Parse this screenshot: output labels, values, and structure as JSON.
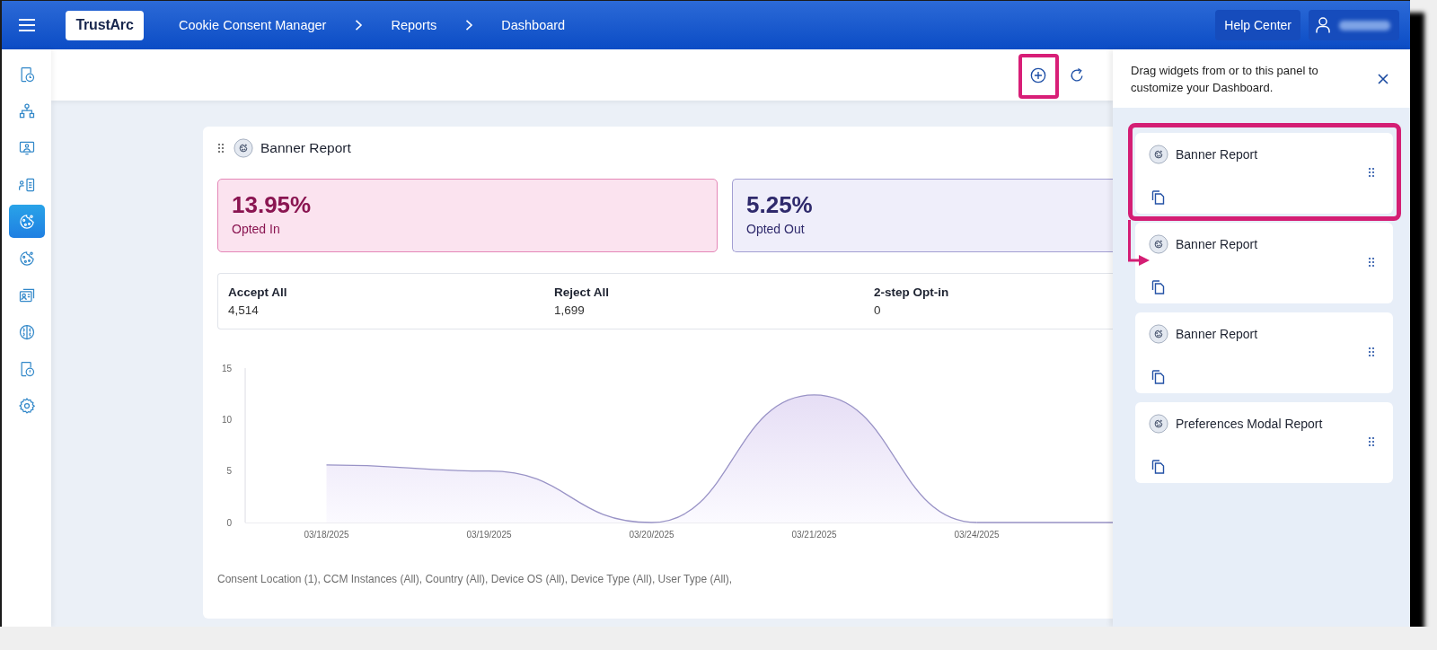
{
  "top_bar": {
    "logo": "TrustArc",
    "breadcrumbs": [
      "Cookie Consent Manager",
      "Reports",
      "Dashboard"
    ],
    "help_button": "Help Center"
  },
  "sidebar": {
    "items": [
      {
        "selected": false
      },
      {
        "selected": false
      },
      {
        "selected": false
      },
      {
        "selected": false
      },
      {
        "selected": true
      },
      {
        "selected": false
      },
      {
        "selected": false
      },
      {
        "selected": false
      },
      {
        "selected": false
      },
      {
        "selected": false
      }
    ]
  },
  "toolbar": {
    "add_highlighted": true
  },
  "widget": {
    "title": "Banner Report",
    "rates": [
      {
        "kind": "opted_in",
        "value": "13.95%",
        "label": "Opted In"
      },
      {
        "kind": "opted_out",
        "value": "5.25%",
        "label": "Opted Out"
      }
    ],
    "counts": [
      {
        "label": "Accept All",
        "value": "4,514"
      },
      {
        "label": "Reject All",
        "value": "1,699"
      },
      {
        "label": "2-step Opt-in",
        "value": "0"
      }
    ],
    "chart_data": {
      "type": "area",
      "categories": [
        "03/18/2025",
        "03/19/2025",
        "03/20/2025",
        "03/21/2025",
        "03/24/2025"
      ],
      "values": [
        5.6,
        5,
        0,
        12.4,
        0
      ],
      "ylim": [
        0,
        15
      ],
      "yticks": [
        0,
        5,
        10,
        15
      ]
    },
    "filters": "Consent Location (1), CCM Instances (All), Country (All), Device OS (All), Device Type (All), User Type (All),"
  },
  "panel": {
    "hint": "Drag widgets from or to this panel to customize your Dashboard.",
    "cards": [
      {
        "title": "Banner Report",
        "highlighted": true
      },
      {
        "title": "Banner Report",
        "highlighted": false
      },
      {
        "title": "Banner Report",
        "highlighted": false
      },
      {
        "title": "Preferences Modal Report",
        "highlighted": false
      }
    ]
  }
}
